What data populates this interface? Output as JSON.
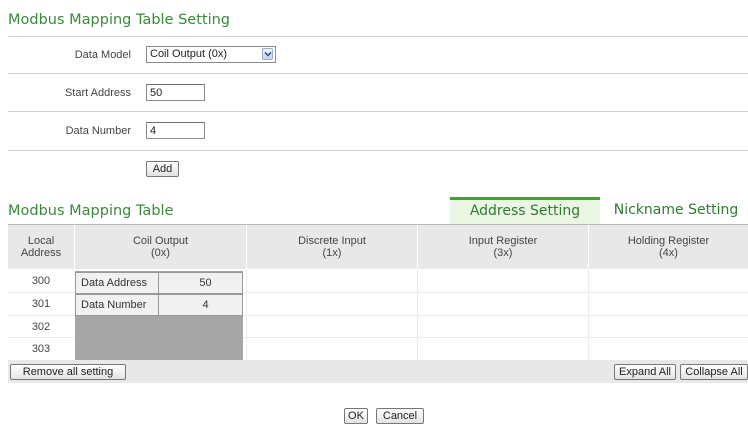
{
  "setting_title": "Modbus Mapping Table Setting",
  "form": {
    "data_model_label": "Data Model",
    "data_model_value": "Coil Output (0x)",
    "start_address_label": "Start Address",
    "start_address_value": "50",
    "data_number_label": "Data Number",
    "data_number_value": "4",
    "add_button": "Add"
  },
  "table_title": "Modbus Mapping Table",
  "tabs": [
    {
      "label": "Address Setting",
      "active": true
    },
    {
      "label": "Nickname Setting",
      "active": false
    }
  ],
  "columns": {
    "local_address": {
      "line1": "Local",
      "line2": "Address"
    },
    "coil_output": {
      "line1": "Coil Output",
      "line2": "(0x)"
    },
    "discrete_input": {
      "line1": "Discrete Input",
      "line2": "(1x)"
    },
    "input_register": {
      "line1": "Input Register",
      "line2": "(3x)"
    },
    "holding_register": {
      "line1": "Holding Register",
      "line2": "(4x)"
    }
  },
  "rows": [
    "300",
    "301",
    "302",
    "303"
  ],
  "mapping_block": {
    "data_address_label": "Data Address",
    "data_address_value": "50",
    "data_number_label": "Data Number",
    "data_number_value": "4"
  },
  "footer": {
    "remove_all": "Remove all setting",
    "expand_all": "Expand All",
    "collapse_all": "Collapse All"
  },
  "dialog": {
    "ok": "OK",
    "cancel": "Cancel"
  },
  "colors": {
    "heading": "#3a8a3a",
    "tab_active_bg": "#eaf5e4",
    "tab_accent": "#4a9b3a",
    "header_bg": "#e8e8e8",
    "block_bg": "#a6a6a6"
  }
}
